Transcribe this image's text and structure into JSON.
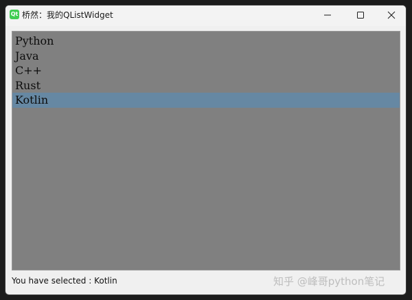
{
  "window": {
    "icon_label": "Qt",
    "title": "桥然：我的QListWidget"
  },
  "list": {
    "items": [
      {
        "label": "Python",
        "selected": false
      },
      {
        "label": "Java",
        "selected": false
      },
      {
        "label": "C++",
        "selected": false
      },
      {
        "label": "Rust",
        "selected": false
      },
      {
        "label": "Kotlin",
        "selected": true
      }
    ]
  },
  "status": {
    "text": "You have selected : Kotlin"
  },
  "watermark": {
    "text": "知乎 @峰哥python笔记"
  },
  "colors": {
    "list_background": "#808080",
    "selection": "#6688a3",
    "qt_green": "#41cd52"
  }
}
